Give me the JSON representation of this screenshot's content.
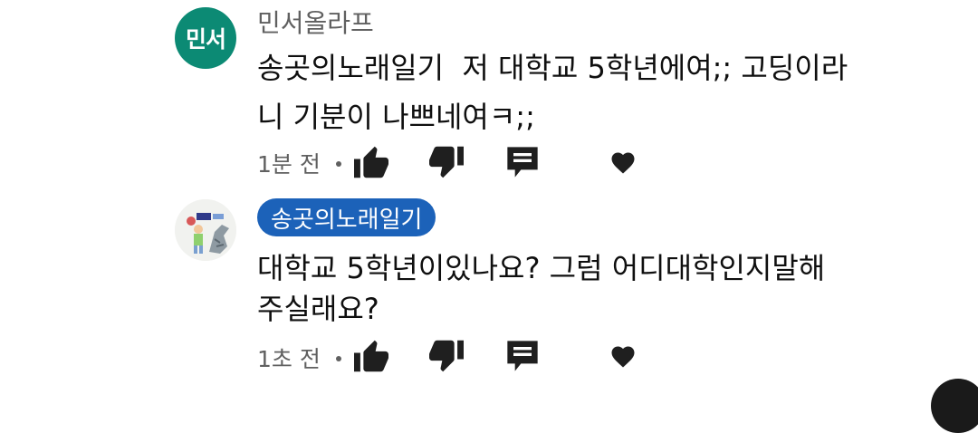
{
  "comments": [
    {
      "avatar_text": "민서",
      "author": "민서올라프",
      "text_line1": "송곳의노래일기  저 대학교 5학년에여;; 고딩이라",
      "text_line2": "니 기분이 나쁘네여ㅋ;;",
      "time": "1분 전",
      "actions": [
        "like-icon",
        "dislike-icon",
        "reply-icon",
        "heart-icon"
      ]
    },
    {
      "author": "송곳의노래일기",
      "text_line1": "대학교 5학년이있나요? 그럼 어디대학인지말해",
      "text_line2": "주실래요?",
      "time": "1초 전",
      "actions": [
        "like-icon",
        "dislike-icon",
        "reply-icon",
        "heart-icon"
      ]
    }
  ],
  "colors": {
    "avatar_green": "#0c8a74",
    "author_chip_blue": "#1c62b9",
    "meta_gray": "#606060"
  }
}
